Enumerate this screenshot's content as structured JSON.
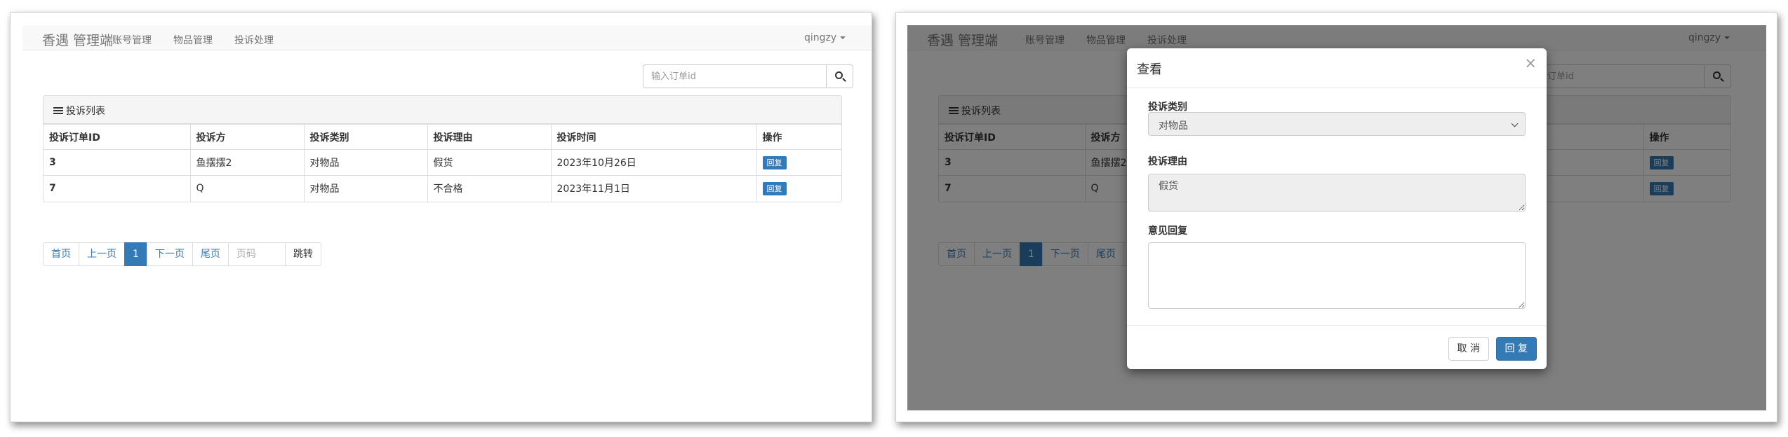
{
  "app": {
    "brand": "香遇 管理端",
    "nav": [
      "账号管理",
      "物品管理",
      "投诉处理"
    ],
    "user": "qingzy"
  },
  "search": {
    "placeholder": "输入订单id"
  },
  "complaints": {
    "heading": "投诉列表",
    "columns": [
      "投诉订单ID",
      "投诉方",
      "投诉类别",
      "投诉理由",
      "投诉时间",
      "操作"
    ],
    "rows": [
      {
        "id": "3",
        "party": "鱼摆摆2",
        "category": "对物品",
        "reason": "假货",
        "time": "2023年10月26日",
        "action": "回复"
      },
      {
        "id": "7",
        "party": "Q",
        "category": "对物品",
        "reason": "不合格",
        "time": "2023年11月1日",
        "action": "回复"
      }
    ]
  },
  "pagination": {
    "first": "首页",
    "prev": "上一页",
    "current": "1",
    "next": "下一页",
    "last": "尾页",
    "page_placeholder": "页码",
    "jump": "跳转"
  },
  "modal": {
    "title": "查看",
    "close": "×",
    "category_label": "投诉类别",
    "category_value": "对物品",
    "reason_label": "投诉理由",
    "reason_value": "假货",
    "reply_label": "意见回复",
    "reply_value": "",
    "cancel": "取 消",
    "submit": "回 复"
  },
  "colors": {
    "primary": "#337ab7",
    "navbar_bg": "#f8f8f8",
    "backdrop": "#000000"
  }
}
